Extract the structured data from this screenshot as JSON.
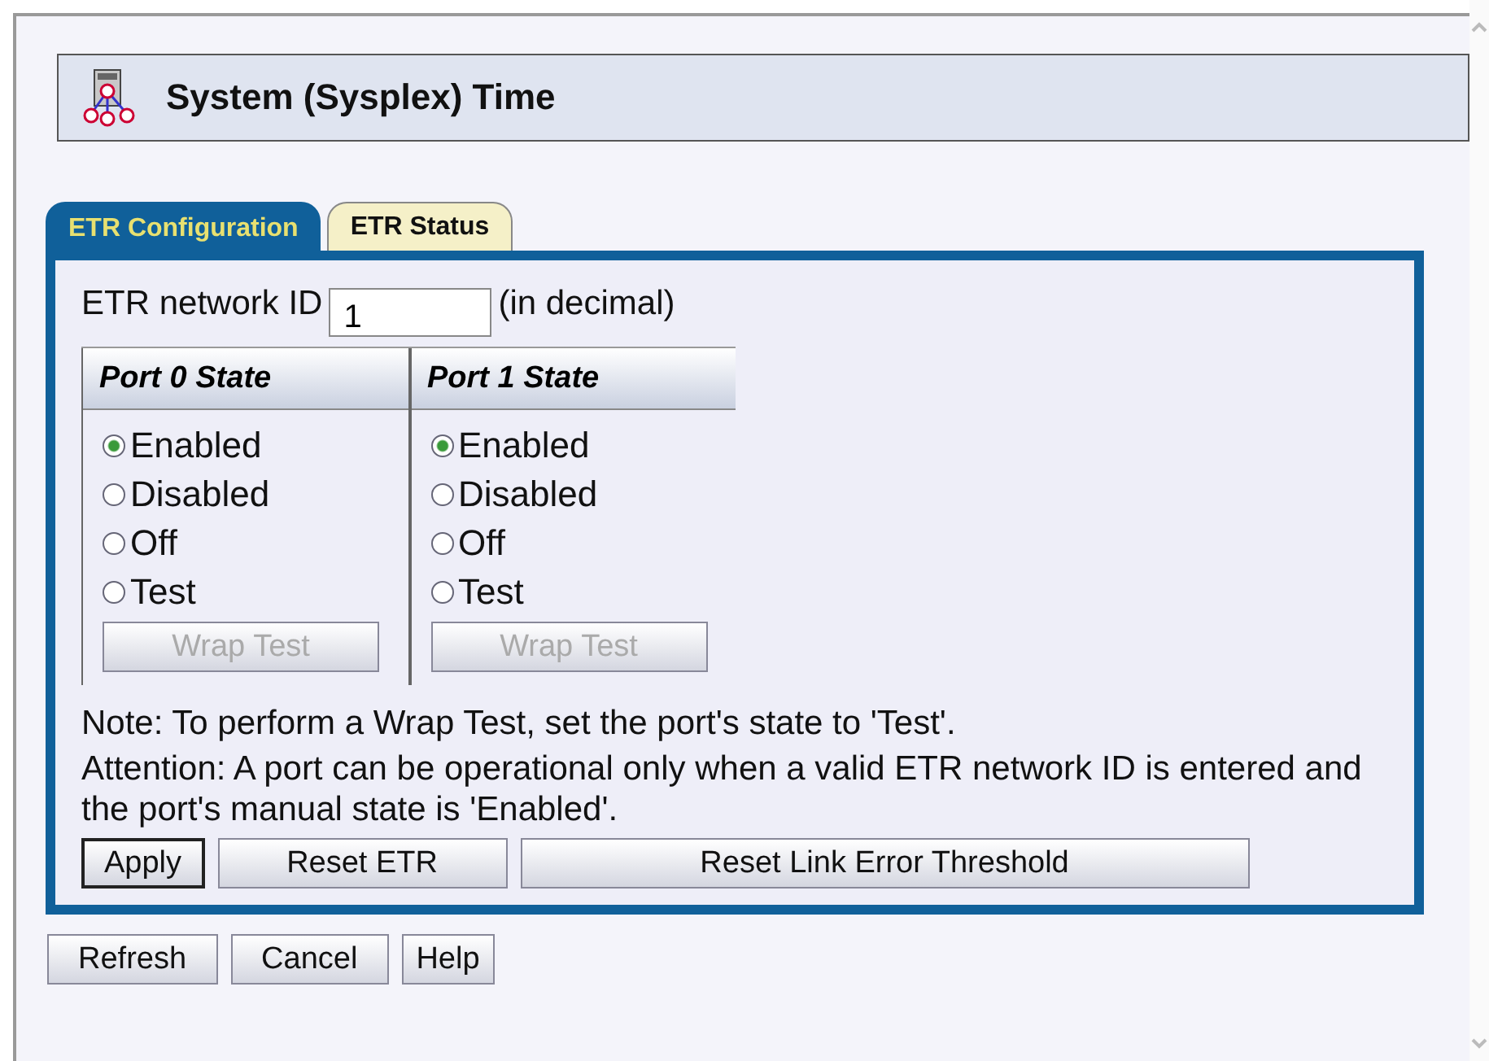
{
  "header": {
    "title": "System (Sysplex) Time"
  },
  "tabs": [
    {
      "label": "ETR Configuration",
      "selected": true
    },
    {
      "label": "ETR Status",
      "selected": false
    }
  ],
  "network_id": {
    "label": "ETR network ID",
    "value": "1",
    "hint": "(in decimal)"
  },
  "ports": [
    {
      "title": "Port 0 State",
      "options": [
        {
          "label": "Enabled",
          "selected": true
        },
        {
          "label": "Disabled",
          "selected": false
        },
        {
          "label": "Off",
          "selected": false
        },
        {
          "label": "Test",
          "selected": false
        }
      ],
      "wrap_button": {
        "label": "Wrap Test",
        "disabled": true
      }
    },
    {
      "title": "Port 1 State",
      "options": [
        {
          "label": "Enabled",
          "selected": true
        },
        {
          "label": "Disabled",
          "selected": false
        },
        {
          "label": "Off",
          "selected": false
        },
        {
          "label": "Test",
          "selected": false
        }
      ],
      "wrap_button": {
        "label": "Wrap Test",
        "disabled": true
      }
    }
  ],
  "note": "Note: To perform a Wrap Test, set the port's state to 'Test'.",
  "attention": "Attention: A port can be operational only when a valid ETR network ID is entered and the port's manual state is 'Enabled'.",
  "actions": [
    {
      "label": "Apply",
      "default": true
    },
    {
      "label": "Reset ETR",
      "default": false
    },
    {
      "label": "Reset Link Error Threshold",
      "default": false
    }
  ],
  "buttons": [
    {
      "label": "Refresh"
    },
    {
      "label": "Cancel"
    },
    {
      "label": "Help"
    }
  ]
}
